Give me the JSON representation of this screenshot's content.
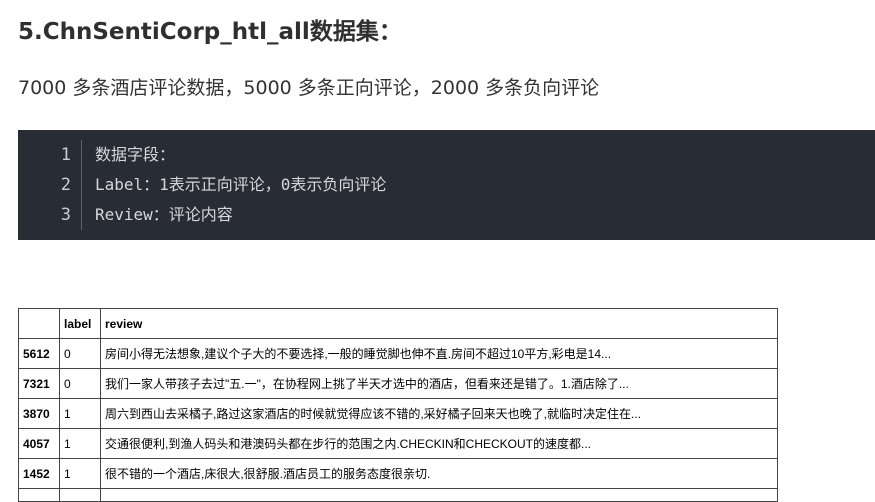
{
  "heading": "5.ChnSentiCorp_htl_all数据集：",
  "description": "7000 多条酒店评论数据，5000 多条正向评论，2000 多条负向评论",
  "code_block": {
    "lines": [
      {
        "number": "1",
        "text": "数据字段："
      },
      {
        "number": "2",
        "text": "Label：1表示正向评论，0表示负向评论"
      },
      {
        "number": "3",
        "text": "Review：评论内容"
      }
    ]
  },
  "table": {
    "headers": [
      "",
      "label",
      "review"
    ],
    "rows": [
      {
        "index": "5612",
        "label": "0",
        "review": "房间小得无法想象,建议个子大的不要选择,一般的睡觉脚也伸不直.房间不超过10平方,彩电是14..."
      },
      {
        "index": "7321",
        "label": "0",
        "review": "我们一家人带孩子去过\"五.一\"，在协程网上挑了半天才选中的酒店，但看来还是错了。1.酒店除了..."
      },
      {
        "index": "3870",
        "label": "1",
        "review": "周六到西山去采橘子,路过这家酒店的时候就觉得应该不错的,采好橘子回来天也晚了,就临时决定住在..."
      },
      {
        "index": "4057",
        "label": "1",
        "review": "交通很便利,到渔人码头和港澳码头都在步行的范围之内.CHECKIN和CHECKOUT的速度都..."
      },
      {
        "index": "1452",
        "label": "1",
        "review": "很不错的一个酒店,床很大,很舒服.酒店员工的服务态度很亲切."
      }
    ]
  }
}
